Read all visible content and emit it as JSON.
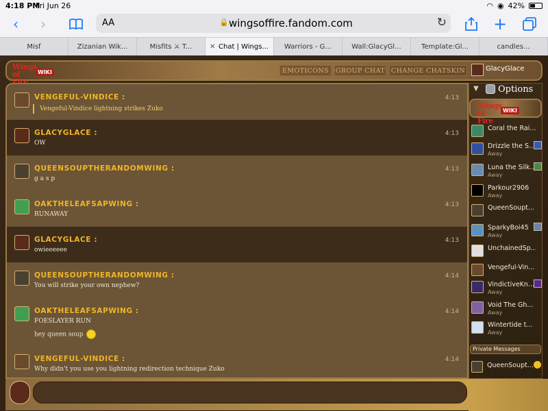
{
  "status_bar": {
    "time": "4:18 PM",
    "date": "Fri Jun 26",
    "battery": "42%",
    "battery_level": 0.42
  },
  "browser": {
    "text_size_label": "AA",
    "url": "wingsoffire.fandom.com",
    "tabs": [
      {
        "label": "Misf"
      },
      {
        "label": "Zizanian Wik..."
      },
      {
        "label": "Misfits ⚔ T..."
      },
      {
        "label": "Chat | Wings...",
        "active": true,
        "close": "✕"
      },
      {
        "label": "Warriors - G..."
      },
      {
        "label": "Wall:GlacyGl..."
      },
      {
        "label": "Template:Gl..."
      },
      {
        "label": "candles..."
      }
    ]
  },
  "colors": {
    "username": "#f0b52a",
    "accent": "#9c7a45",
    "link_blue": "#1a7cf5"
  },
  "header": {
    "logo_text": "Wings of Fire",
    "logo_badge": "WIKI",
    "buttons": [
      "EMOTICONS",
      "GROUP CHAT",
      "CHANGE CHATSKIN"
    ],
    "current_user": "GlacyGlace"
  },
  "messages": [
    {
      "user": "VENGEFUL-VINDICE :",
      "text": "Vengeful-Vindice lightning strikes Zuko",
      "time": "4:13",
      "emote": true,
      "avatar_color": "#6a4a2a",
      "row": "light"
    },
    {
      "user": "GLACYGLACE :",
      "text": "OW",
      "time": "4:13",
      "avatar_color": "#5a2a1a",
      "row": "dark"
    },
    {
      "user": "QUEENSOUPTHERANDOMWING :",
      "text": "g a s p",
      "time": "4:13",
      "avatar_color": "#4a4030",
      "row": "light"
    },
    {
      "user": "OAKTHELEAFSAPWING :",
      "text": "RUNAWAY",
      "time": "4:13",
      "avatar_color": "#40a050",
      "row": "light"
    },
    {
      "user": "GLACYGLACE :",
      "text": "owieeeeee",
      "time": "4:13",
      "avatar_color": "#5a2a1a",
      "row": "dark"
    },
    {
      "user": "QUEENSOUPTHERANDOMWING :",
      "text": "You will strike your own nephew?",
      "time": "4:14",
      "avatar_color": "#4a4030",
      "row": "light"
    },
    {
      "user": "OAKTHELEAFSAPWING :",
      "text": "FOESLAYER RUN",
      "text2": "hey queen soup",
      "smiley": true,
      "time": "4:14",
      "avatar_color": "#40a050",
      "row": "light"
    },
    {
      "user": "VENGEFUL-VINDICE :",
      "text": "Why didn't you use you lightning redirection technique Zuko",
      "time": "4:14",
      "avatar_color": "#6a4a2a",
      "row": "light"
    }
  ],
  "sidebar": {
    "options_label": "Options",
    "users": [
      {
        "name": "Coral the Rai...",
        "status": "",
        "color": "#3a8a6a"
      },
      {
        "name": "Drizzle the S...",
        "status": "Away",
        "color": "#3050a0"
      },
      {
        "name": "Luna the Silk...",
        "status": "Away",
        "color": "#6a8ab0"
      },
      {
        "name": "Parkour2906",
        "status": "Away",
        "color": "#000000"
      },
      {
        "name": "QueenSoupt...",
        "status": "",
        "color": "#4a4030"
      },
      {
        "name": "SparkyBoi45",
        "status": "Away",
        "color": "#5a90c0"
      },
      {
        "name": "UnchainedSp...",
        "status": "",
        "color": "#e0e0e0"
      },
      {
        "name": "Vengeful-Vin...",
        "status": "",
        "color": "#6a4a2a"
      },
      {
        "name": "VindictiveKn...",
        "status": "Away",
        "color": "#3a2a6a"
      },
      {
        "name": "Void The Gh...",
        "status": "Away",
        "color": "#8060a0"
      },
      {
        "name": "Wintertide t...",
        "status": "Away",
        "color": "#d0e0f0"
      }
    ],
    "private_messages_label": "Private Messages",
    "private_messages": [
      {
        "name": "QueenSoupt...",
        "color": "#4a4030"
      }
    ]
  }
}
